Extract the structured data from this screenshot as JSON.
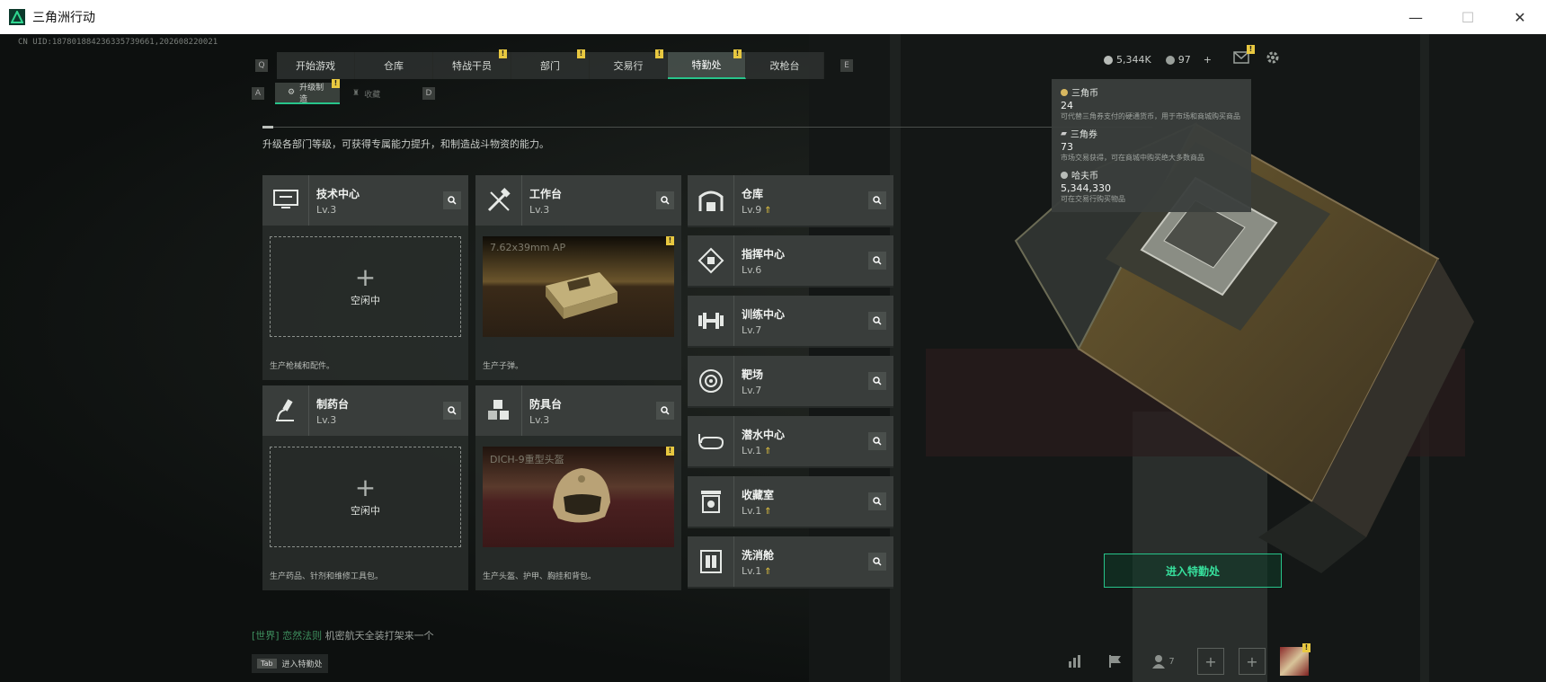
{
  "window": {
    "title": "三角洲行动",
    "controls": [
      "—",
      "☐",
      "✕"
    ]
  },
  "uid": "CN UID:18780188423633573966​1,202608220021",
  "nav": {
    "left_key": "Q",
    "right_key": "E",
    "tabs": [
      {
        "label": "开始游戏",
        "badge": ""
      },
      {
        "label": "仓库",
        "badge": ""
      },
      {
        "label": "特战干员",
        "badge": "!"
      },
      {
        "label": "部门",
        "badge": "!"
      },
      {
        "label": "交易行",
        "badge": "!"
      },
      {
        "label": "特勤处",
        "badge": "!",
        "active": true
      },
      {
        "label": "改枪台",
        "badge": ""
      }
    ]
  },
  "subnav": {
    "left_key": "A",
    "right_key": "D",
    "tabs": [
      {
        "label": "升级制造",
        "badge": "!",
        "active": true
      },
      {
        "label": "收藏"
      }
    ]
  },
  "description": "升级各部门等级，可获得专属能力提升，和制造战斗物资的能力。",
  "cards": [
    {
      "title": "技术中心",
      "level": "Lv.3",
      "slot": "idle",
      "idle_label": "空闲中",
      "footer": "生产枪械和配件。",
      "icon": "computer-icon"
    },
    {
      "title": "工作台",
      "level": "Lv.3",
      "slot": "item",
      "item_name": "7.62x39mm AP",
      "footer": "生产子弹。",
      "icon": "tools-icon"
    },
    {
      "title": "制药台",
      "level": "Lv.3",
      "slot": "idle",
      "idle_label": "空闲中",
      "footer": "生产药品、针剂和维修工具包。",
      "icon": "microscope-icon"
    },
    {
      "title": "防具台",
      "level": "Lv.3",
      "slot": "item",
      "item_name": "DICH-9重型头盔",
      "footer": "生产头盔、护甲、胸挂和背包。",
      "icon": "cubes-icon"
    }
  ],
  "facilities": [
    {
      "title": "仓库",
      "level": "Lv.9",
      "upgrade": true,
      "icon": "warehouse-icon"
    },
    {
      "title": "指挥中心",
      "level": "Lv.6",
      "upgrade": false,
      "icon": "command-icon"
    },
    {
      "title": "训练中心",
      "level": "Lv.7",
      "upgrade": false,
      "icon": "dumbbell-icon"
    },
    {
      "title": "靶场",
      "level": "Lv.7",
      "upgrade": false,
      "icon": "target-icon"
    },
    {
      "title": "潜水中心",
      "level": "Lv.1",
      "upgrade": true,
      "icon": "diving-mask-icon"
    },
    {
      "title": "收藏室",
      "level": "Lv.1",
      "upgrade": true,
      "icon": "collection-icon"
    },
    {
      "title": "洗消舱",
      "level": "Lv.1",
      "upgrade": true,
      "icon": "decon-icon"
    }
  ],
  "currency": {
    "havoc": "5,344K",
    "tickets": "97",
    "plus": "+"
  },
  "tooltip": [
    {
      "name": "三角币",
      "value": "24",
      "desc": "可代替三角券支付的硬通货币，用于市场和商城购买商品"
    },
    {
      "name": "三角券",
      "value": "73",
      "desc": "市场交易获得，可在商城中购买绝大多数商品"
    },
    {
      "name": "哈夫币",
      "value": "5,344,330",
      "desc": "可在交易行购买物品"
    }
  ],
  "chat": {
    "channel": "[世界]",
    "sender": "恋然法则",
    "message": "机密航天全装打架来一个"
  },
  "tab_hint": {
    "key": "Tab",
    "label": "进入特勤处"
  },
  "enter_button": "进入特勤处",
  "bottom": {
    "friends_count": "7"
  },
  "colors": {
    "accent": "#27c48a",
    "badge": "#e8c840"
  }
}
